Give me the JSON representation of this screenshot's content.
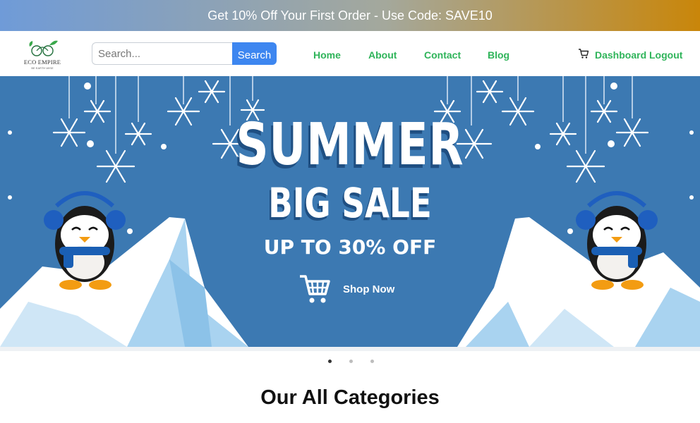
{
  "promo": {
    "text": "Get 10% Off Your First Order - Use Code: SAVE10"
  },
  "logo": {
    "name": "ECO EMPIRE",
    "tagline": "BE EARTH WISE"
  },
  "search": {
    "placeholder": "Search...",
    "button_label": "Search"
  },
  "nav": {
    "home": "Home",
    "about": "About",
    "contact": "Contact",
    "blog": "Blog"
  },
  "user_nav": {
    "dashboard": "Dashboard",
    "logout": "Logout"
  },
  "hero": {
    "line1": "SUMMER",
    "line2": "BIG SALE",
    "line3": "UP TO 30% OFF",
    "cta": "Shop Now"
  },
  "carousel": {
    "slide_count": 3,
    "active_index": 0
  },
  "categories": {
    "title": "Our All Categories"
  },
  "colors": {
    "accent_green": "#2fb45a",
    "search_blue": "#3d86f0",
    "hero_blue": "#3c79b2"
  }
}
